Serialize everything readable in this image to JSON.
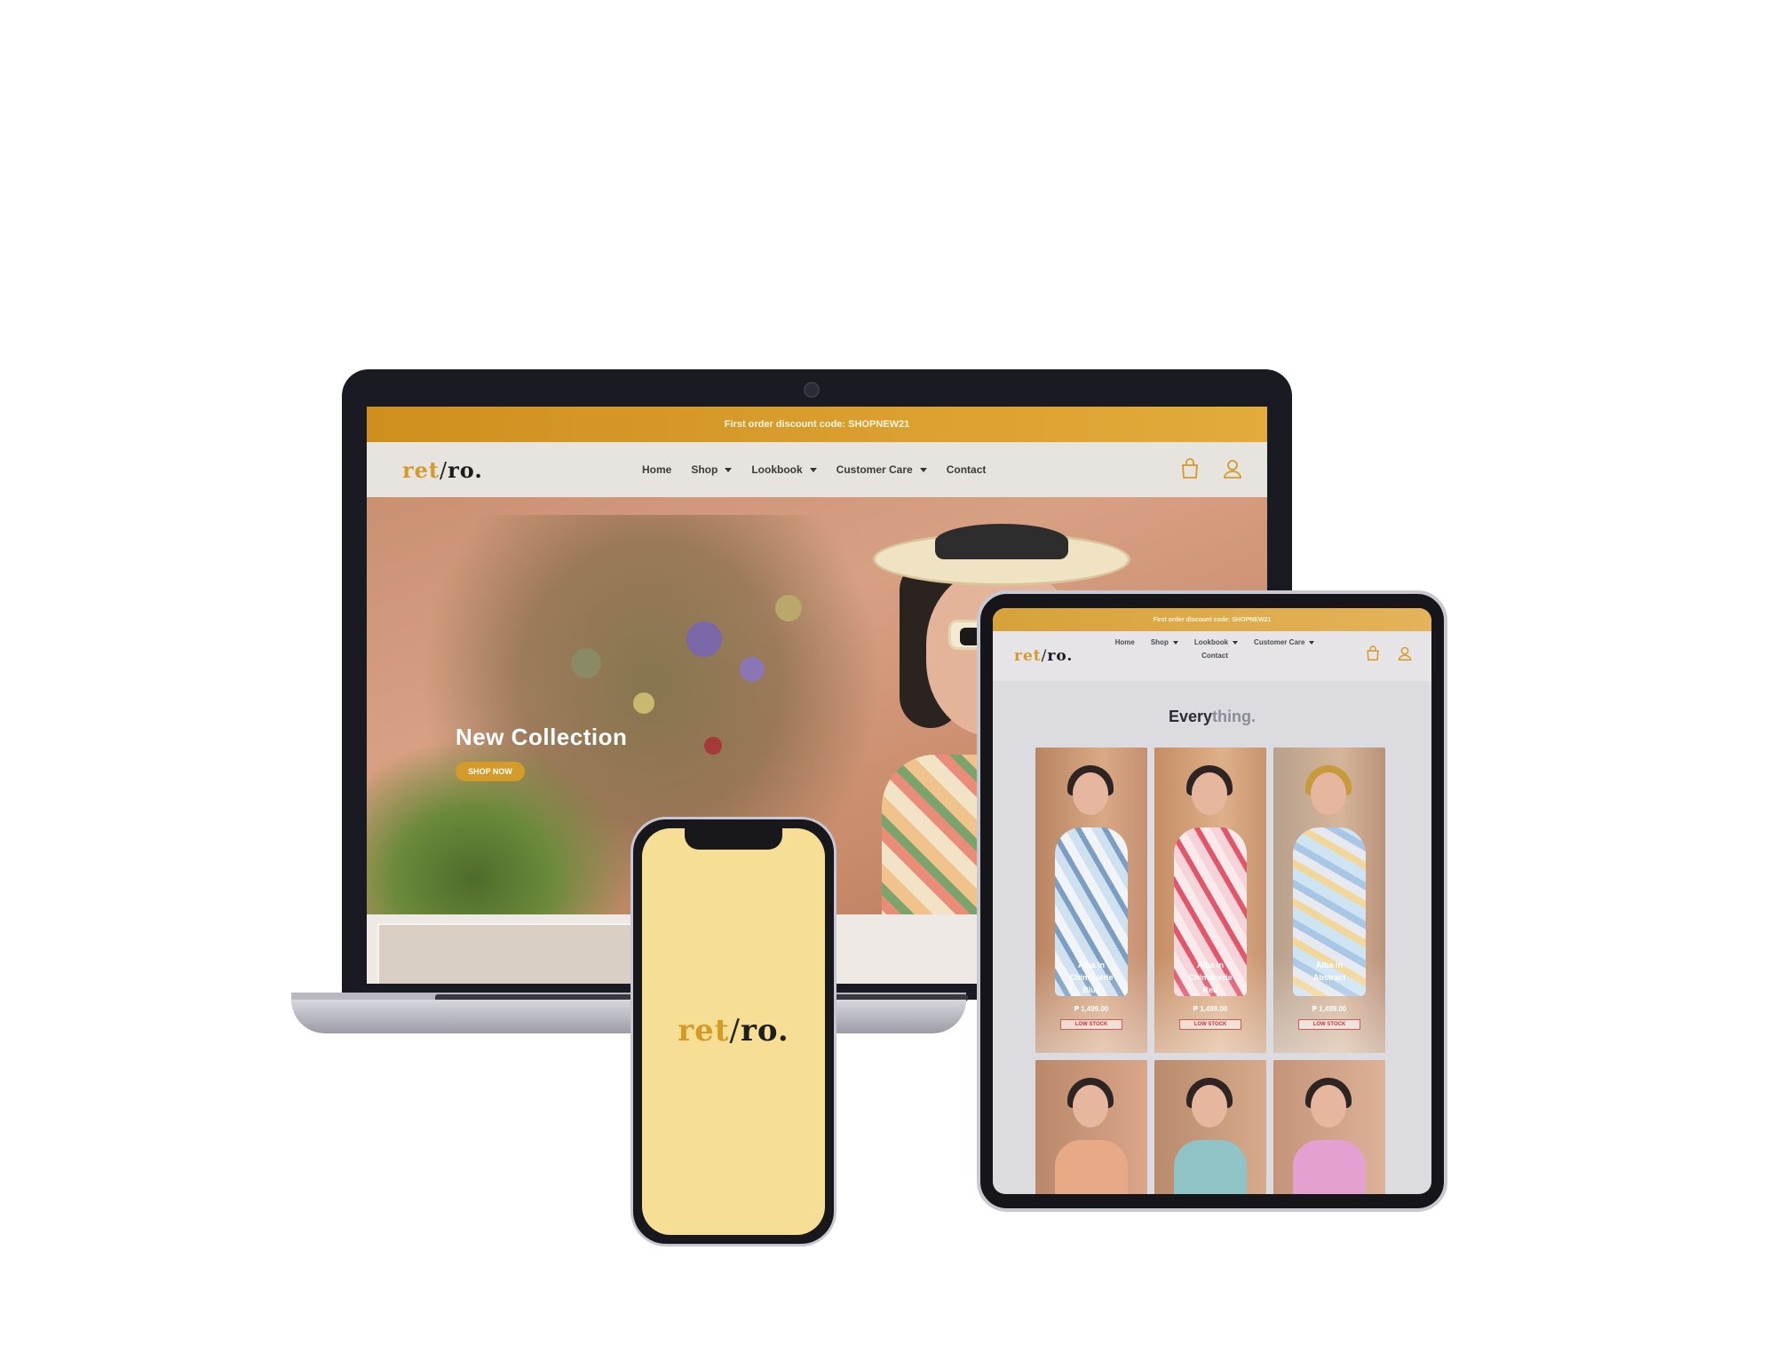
{
  "laptop": {
    "promo_text": "First order discount code: SHOPNEW21",
    "logo": {
      "ret": "ret",
      "slash": "/",
      "ro": "ro."
    },
    "nav": [
      {
        "label": "Home",
        "has_dropdown": false
      },
      {
        "label": "Shop",
        "has_dropdown": true
      },
      {
        "label": "Lookbook",
        "has_dropdown": true
      },
      {
        "label": "Customer Care",
        "has_dropdown": true
      },
      {
        "label": "Contact",
        "has_dropdown": false
      }
    ],
    "icons": [
      "shopping-bag-icon",
      "user-icon"
    ],
    "hero_title": "New Collection",
    "hero_button": "SHOP NOW"
  },
  "tablet": {
    "promo_text": "First order discount code: SHOPNEW21",
    "logo": {
      "ret": "ret",
      "slash": "/",
      "ro": "ro."
    },
    "nav": [
      {
        "label": "Home",
        "has_dropdown": false
      },
      {
        "label": "Shop",
        "has_dropdown": true
      },
      {
        "label": "Lookbook",
        "has_dropdown": true
      },
      {
        "label": "Customer Care",
        "has_dropdown": true
      },
      {
        "label": "Contact",
        "has_dropdown": false
      }
    ],
    "heading_main": "Every",
    "heading_accent": "thing.",
    "products": [
      {
        "name_lines": [
          "Alba in",
          "Chinoiserie",
          "Blue"
        ],
        "price": "₱ 1,499.00",
        "badge": "LOW STOCK"
      },
      {
        "name_lines": [
          "Alba in",
          "Chinoiserie",
          "Red"
        ],
        "price": "₱ 1,499.00",
        "badge": "LOW STOCK"
      },
      {
        "name_lines": [
          "Alba in",
          "Abstract"
        ],
        "price": "₱ 1,499.00",
        "badge": "LOW STOCK"
      }
    ]
  },
  "phone": {
    "logo": {
      "ret": "ret",
      "slash": "/",
      "ro": "ro."
    }
  },
  "colors": {
    "accent": "#d49a2a",
    "promo_start": "#cf8f1f",
    "promo_end": "#e2ab3b",
    "phone_bg": "#f6df95"
  }
}
